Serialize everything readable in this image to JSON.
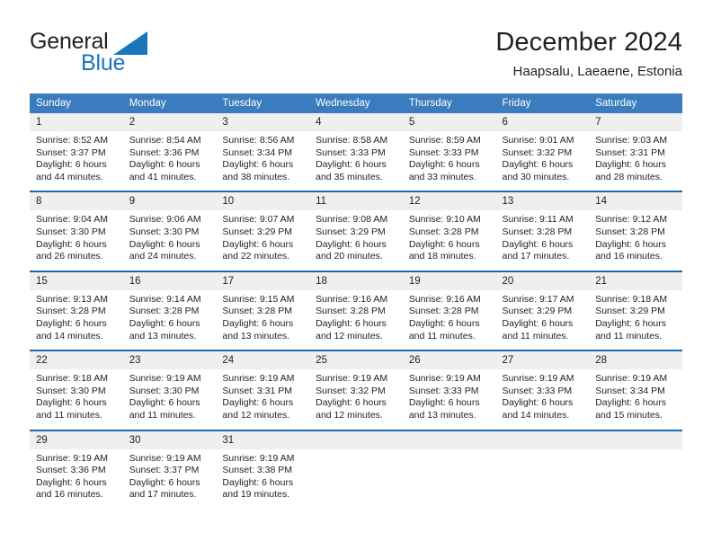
{
  "brand": {
    "name_part1": "General",
    "name_part2": "Blue",
    "icon": "triangle-logo-icon",
    "color_dark": "#231f20",
    "color_blue": "#1b75bb"
  },
  "header": {
    "title": "December 2024",
    "subtitle": "Haapsalu, Laeaene, Estonia"
  },
  "theme": {
    "header_bg": "#3a7cbe",
    "separator": "#1b6ab0",
    "daynum_bg": "#efefef",
    "text": "#231f20"
  },
  "calendar": {
    "weekday_headers": [
      "Sunday",
      "Monday",
      "Tuesday",
      "Wednesday",
      "Thursday",
      "Friday",
      "Saturday"
    ],
    "weeks": [
      [
        {
          "day": "1",
          "sunrise": "Sunrise: 8:52 AM",
          "sunset": "Sunset: 3:37 PM",
          "daylight_line1": "Daylight: 6 hours",
          "daylight_line2": "and 44 minutes."
        },
        {
          "day": "2",
          "sunrise": "Sunrise: 8:54 AM",
          "sunset": "Sunset: 3:36 PM",
          "daylight_line1": "Daylight: 6 hours",
          "daylight_line2": "and 41 minutes."
        },
        {
          "day": "3",
          "sunrise": "Sunrise: 8:56 AM",
          "sunset": "Sunset: 3:34 PM",
          "daylight_line1": "Daylight: 6 hours",
          "daylight_line2": "and 38 minutes."
        },
        {
          "day": "4",
          "sunrise": "Sunrise: 8:58 AM",
          "sunset": "Sunset: 3:33 PM",
          "daylight_line1": "Daylight: 6 hours",
          "daylight_line2": "and 35 minutes."
        },
        {
          "day": "5",
          "sunrise": "Sunrise: 8:59 AM",
          "sunset": "Sunset: 3:33 PM",
          "daylight_line1": "Daylight: 6 hours",
          "daylight_line2": "and 33 minutes."
        },
        {
          "day": "6",
          "sunrise": "Sunrise: 9:01 AM",
          "sunset": "Sunset: 3:32 PM",
          "daylight_line1": "Daylight: 6 hours",
          "daylight_line2": "and 30 minutes."
        },
        {
          "day": "7",
          "sunrise": "Sunrise: 9:03 AM",
          "sunset": "Sunset: 3:31 PM",
          "daylight_line1": "Daylight: 6 hours",
          "daylight_line2": "and 28 minutes."
        }
      ],
      [
        {
          "day": "8",
          "sunrise": "Sunrise: 9:04 AM",
          "sunset": "Sunset: 3:30 PM",
          "daylight_line1": "Daylight: 6 hours",
          "daylight_line2": "and 26 minutes."
        },
        {
          "day": "9",
          "sunrise": "Sunrise: 9:06 AM",
          "sunset": "Sunset: 3:30 PM",
          "daylight_line1": "Daylight: 6 hours",
          "daylight_line2": "and 24 minutes."
        },
        {
          "day": "10",
          "sunrise": "Sunrise: 9:07 AM",
          "sunset": "Sunset: 3:29 PM",
          "daylight_line1": "Daylight: 6 hours",
          "daylight_line2": "and 22 minutes."
        },
        {
          "day": "11",
          "sunrise": "Sunrise: 9:08 AM",
          "sunset": "Sunset: 3:29 PM",
          "daylight_line1": "Daylight: 6 hours",
          "daylight_line2": "and 20 minutes."
        },
        {
          "day": "12",
          "sunrise": "Sunrise: 9:10 AM",
          "sunset": "Sunset: 3:28 PM",
          "daylight_line1": "Daylight: 6 hours",
          "daylight_line2": "and 18 minutes."
        },
        {
          "day": "13",
          "sunrise": "Sunrise: 9:11 AM",
          "sunset": "Sunset: 3:28 PM",
          "daylight_line1": "Daylight: 6 hours",
          "daylight_line2": "and 17 minutes."
        },
        {
          "day": "14",
          "sunrise": "Sunrise: 9:12 AM",
          "sunset": "Sunset: 3:28 PM",
          "daylight_line1": "Daylight: 6 hours",
          "daylight_line2": "and 16 minutes."
        }
      ],
      [
        {
          "day": "15",
          "sunrise": "Sunrise: 9:13 AM",
          "sunset": "Sunset: 3:28 PM",
          "daylight_line1": "Daylight: 6 hours",
          "daylight_line2": "and 14 minutes."
        },
        {
          "day": "16",
          "sunrise": "Sunrise: 9:14 AM",
          "sunset": "Sunset: 3:28 PM",
          "daylight_line1": "Daylight: 6 hours",
          "daylight_line2": "and 13 minutes."
        },
        {
          "day": "17",
          "sunrise": "Sunrise: 9:15 AM",
          "sunset": "Sunset: 3:28 PM",
          "daylight_line1": "Daylight: 6 hours",
          "daylight_line2": "and 13 minutes."
        },
        {
          "day": "18",
          "sunrise": "Sunrise: 9:16 AM",
          "sunset": "Sunset: 3:28 PM",
          "daylight_line1": "Daylight: 6 hours",
          "daylight_line2": "and 12 minutes."
        },
        {
          "day": "19",
          "sunrise": "Sunrise: 9:16 AM",
          "sunset": "Sunset: 3:28 PM",
          "daylight_line1": "Daylight: 6 hours",
          "daylight_line2": "and 11 minutes."
        },
        {
          "day": "20",
          "sunrise": "Sunrise: 9:17 AM",
          "sunset": "Sunset: 3:29 PM",
          "daylight_line1": "Daylight: 6 hours",
          "daylight_line2": "and 11 minutes."
        },
        {
          "day": "21",
          "sunrise": "Sunrise: 9:18 AM",
          "sunset": "Sunset: 3:29 PM",
          "daylight_line1": "Daylight: 6 hours",
          "daylight_line2": "and 11 minutes."
        }
      ],
      [
        {
          "day": "22",
          "sunrise": "Sunrise: 9:18 AM",
          "sunset": "Sunset: 3:30 PM",
          "daylight_line1": "Daylight: 6 hours",
          "daylight_line2": "and 11 minutes."
        },
        {
          "day": "23",
          "sunrise": "Sunrise: 9:19 AM",
          "sunset": "Sunset: 3:30 PM",
          "daylight_line1": "Daylight: 6 hours",
          "daylight_line2": "and 11 minutes."
        },
        {
          "day": "24",
          "sunrise": "Sunrise: 9:19 AM",
          "sunset": "Sunset: 3:31 PM",
          "daylight_line1": "Daylight: 6 hours",
          "daylight_line2": "and 12 minutes."
        },
        {
          "day": "25",
          "sunrise": "Sunrise: 9:19 AM",
          "sunset": "Sunset: 3:32 PM",
          "daylight_line1": "Daylight: 6 hours",
          "daylight_line2": "and 12 minutes."
        },
        {
          "day": "26",
          "sunrise": "Sunrise: 9:19 AM",
          "sunset": "Sunset: 3:33 PM",
          "daylight_line1": "Daylight: 6 hours",
          "daylight_line2": "and 13 minutes."
        },
        {
          "day": "27",
          "sunrise": "Sunrise: 9:19 AM",
          "sunset": "Sunset: 3:33 PM",
          "daylight_line1": "Daylight: 6 hours",
          "daylight_line2": "and 14 minutes."
        },
        {
          "day": "28",
          "sunrise": "Sunrise: 9:19 AM",
          "sunset": "Sunset: 3:34 PM",
          "daylight_line1": "Daylight: 6 hours",
          "daylight_line2": "and 15 minutes."
        }
      ],
      [
        {
          "day": "29",
          "sunrise": "Sunrise: 9:19 AM",
          "sunset": "Sunset: 3:36 PM",
          "daylight_line1": "Daylight: 6 hours",
          "daylight_line2": "and 16 minutes."
        },
        {
          "day": "30",
          "sunrise": "Sunrise: 9:19 AM",
          "sunset": "Sunset: 3:37 PM",
          "daylight_line1": "Daylight: 6 hours",
          "daylight_line2": "and 17 minutes."
        },
        {
          "day": "31",
          "sunrise": "Sunrise: 9:19 AM",
          "sunset": "Sunset: 3:38 PM",
          "daylight_line1": "Daylight: 6 hours",
          "daylight_line2": "and 19 minutes."
        },
        {
          "day": "",
          "sunrise": "",
          "sunset": "",
          "daylight_line1": "",
          "daylight_line2": ""
        },
        {
          "day": "",
          "sunrise": "",
          "sunset": "",
          "daylight_line1": "",
          "daylight_line2": ""
        },
        {
          "day": "",
          "sunrise": "",
          "sunset": "",
          "daylight_line1": "",
          "daylight_line2": ""
        },
        {
          "day": "",
          "sunrise": "",
          "sunset": "",
          "daylight_line1": "",
          "daylight_line2": ""
        }
      ]
    ]
  }
}
